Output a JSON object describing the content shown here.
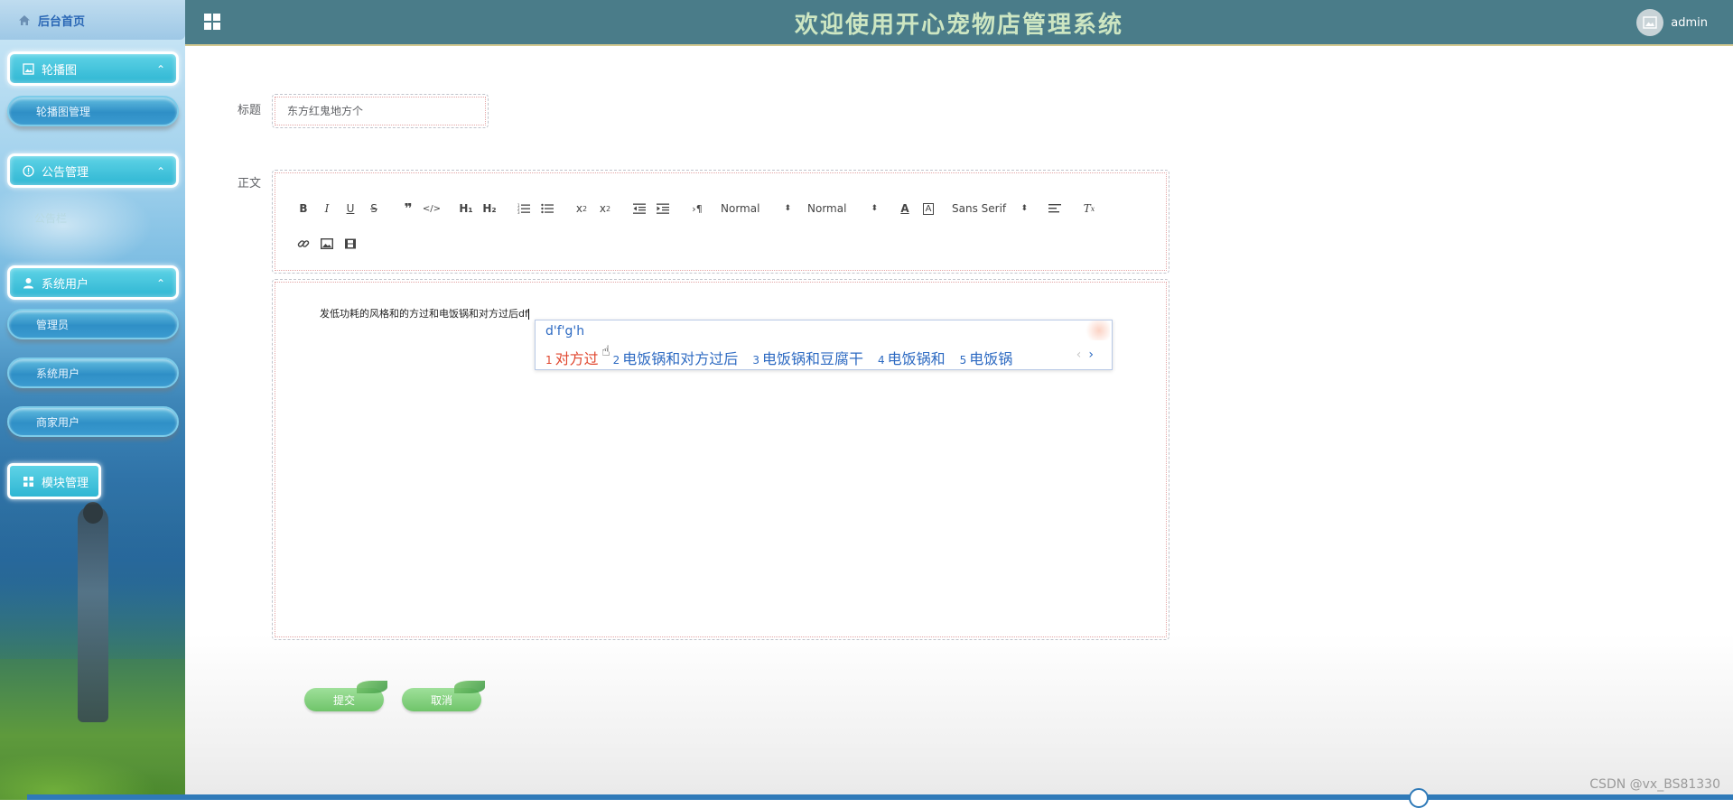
{
  "header": {
    "title": "欢迎使用开心宠物店管理系统",
    "username": "admin"
  },
  "sidebar": {
    "home_label": "后台首页",
    "groups": [
      {
        "label": "轮播图",
        "items": [
          "轮播图管理"
        ]
      },
      {
        "label": "公告管理",
        "items": [
          "公告栏"
        ]
      },
      {
        "label": "系统用户",
        "items": [
          "管理员",
          "系统用户",
          "商家用户"
        ]
      }
    ],
    "module_label": "模块管理"
  },
  "form": {
    "title_label": "标题",
    "title_value": "东方红鬼地方个",
    "body_label": "正文",
    "body_text": "发低功耗的风格和的方过和电饭锅和对方过后df"
  },
  "toolbar": {
    "select_header": "Normal",
    "select_size": "Normal",
    "select_font": "Sans Serif"
  },
  "ime": {
    "code": "d'f'g'h",
    "candidates": [
      {
        "n": "1",
        "text": "对方过"
      },
      {
        "n": "2",
        "text": "电饭锅和对方过后"
      },
      {
        "n": "3",
        "text": "电饭锅和豆腐干"
      },
      {
        "n": "4",
        "text": "电饭锅和"
      },
      {
        "n": "5",
        "text": "电饭锅"
      }
    ]
  },
  "buttons": {
    "submit": "提交",
    "cancel": "取消"
  },
  "watermark": "CSDN @vx_BS81330"
}
